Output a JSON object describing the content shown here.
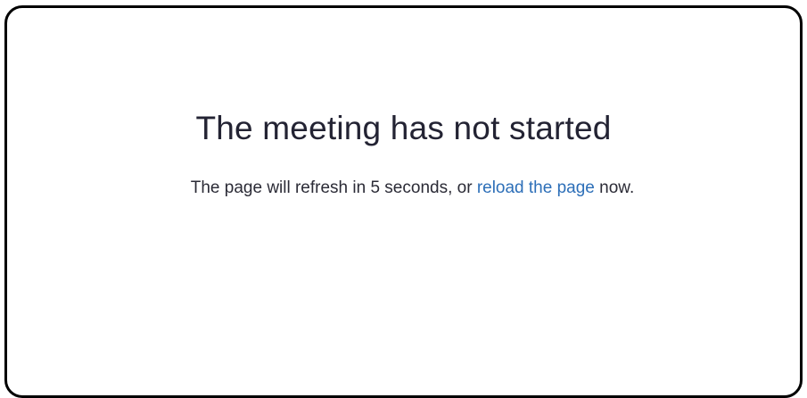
{
  "main": {
    "title": "The meeting has not started",
    "message_before": "The page will refresh in 5 seconds, or ",
    "reload_link": "reload the page",
    "message_after": " now."
  },
  "colors": {
    "text": "#232333",
    "link": "#2d6fb8",
    "frame_border": "#000000"
  }
}
